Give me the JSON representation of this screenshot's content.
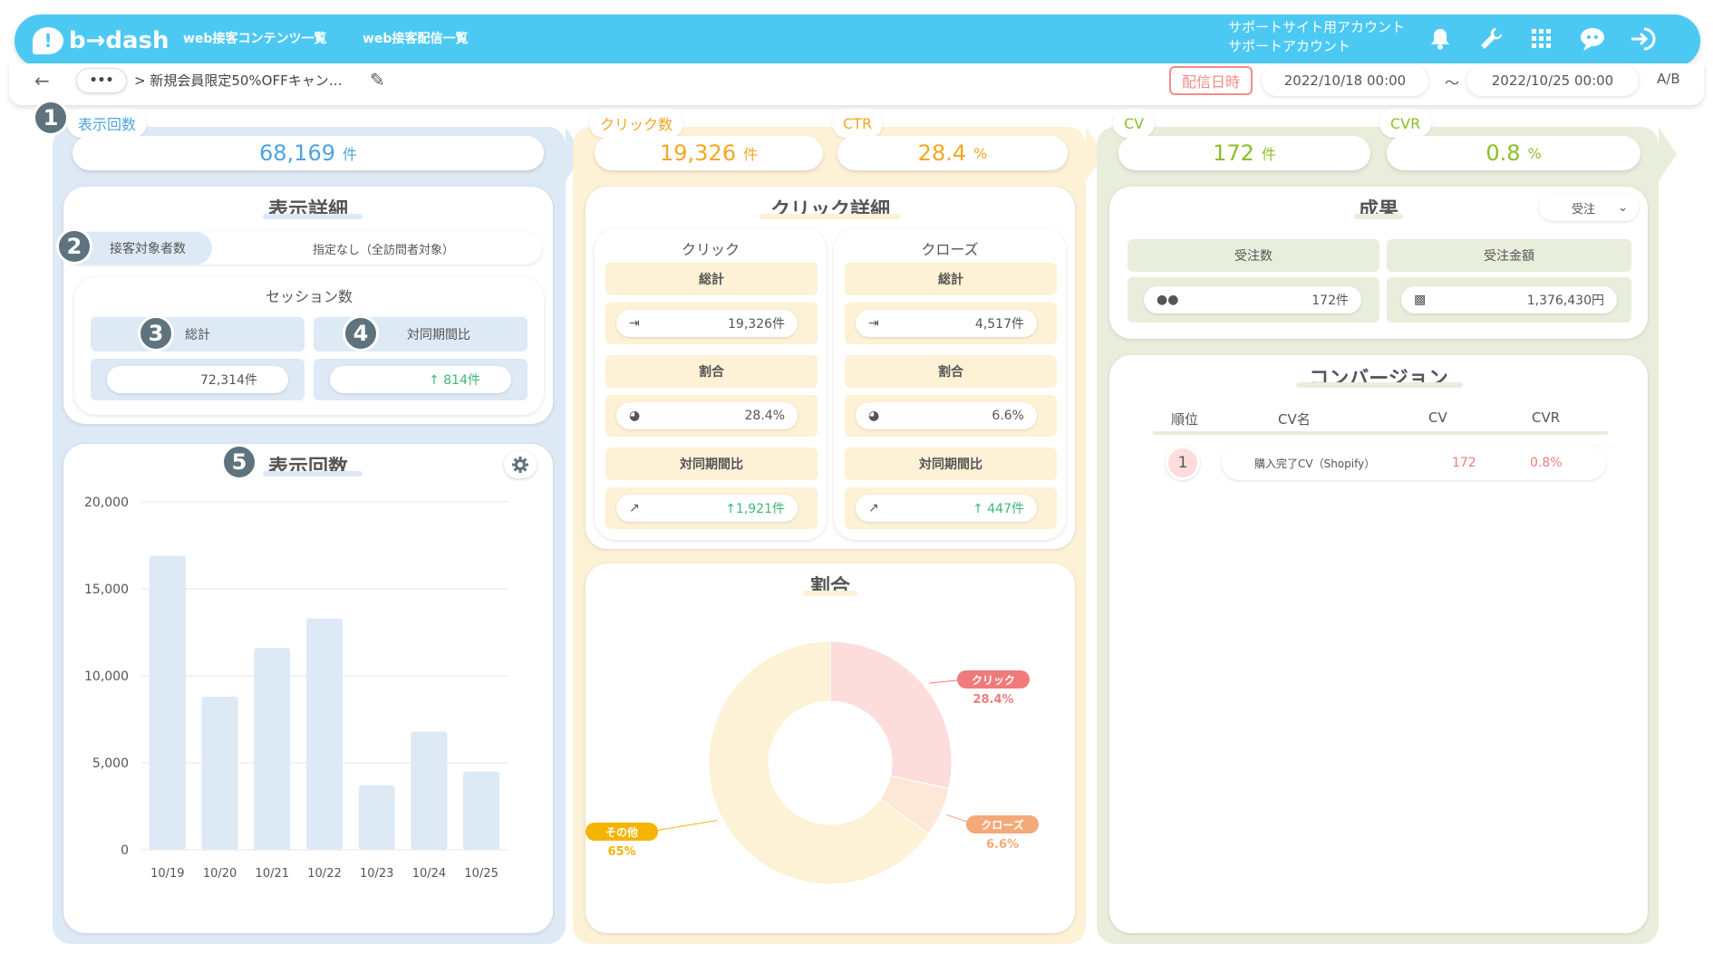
{
  "header": {
    "logo": "b→dash",
    "nav": [
      "web接客コンテンツ一覧",
      "web接客配信一覧"
    ],
    "account_line1": "サポートサイト用アカウント",
    "account_line2": "サポートアカウント",
    "icons": [
      "bell-icon",
      "wrench-icon",
      "grid-icon",
      "chat-icon",
      "logout-icon"
    ]
  },
  "subbar": {
    "dots": "•••",
    "breadcrumb": "> 新規会員限定50%OFFキャン…",
    "date_label": "配信日時",
    "date_from": "2022/10/18 00:00",
    "tilde": "〜",
    "date_to": "2022/10/25 00:00",
    "ab": "A/B"
  },
  "kpis": {
    "impressions": {
      "label": "表示回数",
      "value": "68,169",
      "unit": "件"
    },
    "clicks": {
      "label": "クリック数",
      "value": "19,326",
      "unit": "件"
    },
    "ctr": {
      "label": "CTR",
      "value": "28.4",
      "unit": "%"
    },
    "cv": {
      "label": "CV",
      "value": "172",
      "unit": "件"
    },
    "cvr": {
      "label": "CVR",
      "value": "0.8",
      "unit": "%"
    }
  },
  "display_detail": {
    "title": "表示詳細",
    "target_label": "接客対象者数",
    "target_value": "指定なし（全訪問者対象）",
    "session_title": "セッション数",
    "total_label": "総計",
    "total_value": "72,314件",
    "yoy_label": "対同期間比",
    "yoy_value": "↑ 814件"
  },
  "badges": [
    "1",
    "2",
    "3",
    "4",
    "5"
  ],
  "impressions_chart": {
    "title": "表示回数"
  },
  "chart_data": {
    "type": "bar",
    "categories": [
      "10/19",
      "10/20",
      "10/21",
      "10/22",
      "10/23",
      "10/24",
      "10/25"
    ],
    "values": [
      16900,
      8800,
      11600,
      13300,
      3700,
      6800,
      4500
    ],
    "ylim": [
      0,
      20000
    ],
    "yticks": [
      "0",
      "5,000",
      "10,000",
      "15,000",
      "20,000"
    ],
    "bar_color": "#dde9f5",
    "grid": true
  },
  "click_detail": {
    "title": "クリック詳細",
    "click": {
      "header": "クリック",
      "total_label": "総計",
      "total": "19,326件",
      "ratio_label": "割合",
      "ratio": "28.4%",
      "yoy_label": "対同期間比",
      "yoy": "↑1,921件"
    },
    "close": {
      "header": "クローズ",
      "total_label": "総計",
      "total": "4,517件",
      "ratio_label": "割合",
      "ratio": "6.6%",
      "yoy_label": "対同期間比",
      "yoy": "↑ 447件"
    }
  },
  "ratio_chart": {
    "title": "割合",
    "slices": [
      {
        "name": "クリック",
        "value": 28.4,
        "label": "28.4%",
        "color": "#fddcdc",
        "tag_color": "#f07b7b"
      },
      {
        "name": "クローズ",
        "value": 6.6,
        "label": "6.6%",
        "color": "#fde8d8",
        "tag_color": "#f5a878"
      },
      {
        "name": "その他",
        "value": 65,
        "label": "65%",
        "color": "#fdf1d6",
        "tag_color": "#f5b400"
      }
    ]
  },
  "results": {
    "title": "成果",
    "select": "受注",
    "orders_label": "受注数",
    "orders_value": "172件",
    "amount_label": "受注金額",
    "amount_value": "1,376,430円"
  },
  "conversion": {
    "title": "コンバージョン",
    "columns": [
      "順位",
      "CV名",
      "CV",
      "CVR"
    ],
    "rows": [
      {
        "rank": "1",
        "name": "購入完了CV（Shopify）",
        "cv": "172",
        "cvr": "0.8%"
      }
    ]
  },
  "colors": {
    "blue": "#4fa3e0",
    "yellow": "#f5a623",
    "green": "#8cbf26",
    "accent": "#4cc9f2"
  }
}
